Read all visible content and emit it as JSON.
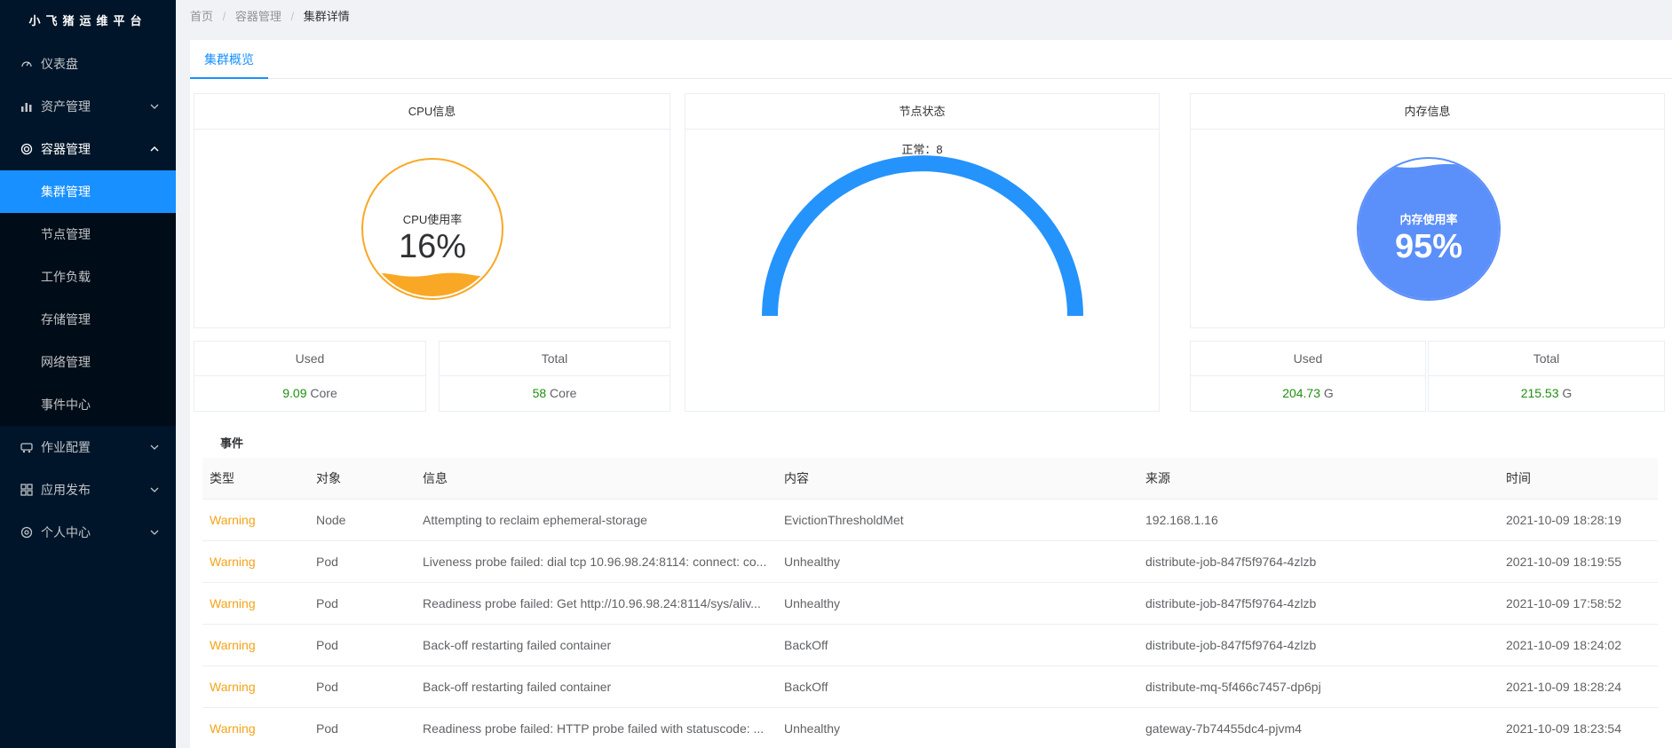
{
  "brand": "小飞猪运维平台",
  "sidebar": {
    "items": [
      {
        "label": "仪表盘",
        "icon": "dashboard-icon"
      },
      {
        "label": "资产管理",
        "icon": "asset-icon"
      },
      {
        "label": "容器管理",
        "icon": "container-icon"
      },
      {
        "label": "作业配置",
        "icon": "job-icon"
      },
      {
        "label": "应用发布",
        "icon": "app-icon"
      },
      {
        "label": "个人中心",
        "icon": "user-icon"
      }
    ],
    "sub_items": [
      {
        "label": "集群管理",
        "active": true
      },
      {
        "label": "节点管理"
      },
      {
        "label": "工作负载"
      },
      {
        "label": "存储管理"
      },
      {
        "label": "网络管理"
      },
      {
        "label": "事件中心"
      }
    ]
  },
  "breadcrumb": {
    "home": "首页",
    "sep": "/",
    "parent": "容器管理",
    "current": "集群详情"
  },
  "tab": {
    "label": "集群概览"
  },
  "cpu": {
    "title": "CPU信息",
    "gauge_label": "CPU使用率",
    "gauge_value": "16%",
    "usage_fraction": 0.16,
    "color": "#f9a825",
    "used_label": "Used",
    "used_value": "9.09",
    "used_unit": "Core",
    "total_label": "Total",
    "total_value": "58",
    "total_unit": "Core"
  },
  "nodes": {
    "title": "节点状态",
    "status_text": "正常：8",
    "color": "#2593fc"
  },
  "memory": {
    "title": "内存信息",
    "gauge_label": "内存使用率",
    "gauge_value": "95%",
    "usage_fraction": 0.95,
    "color": "#5b8ff9",
    "used_label": "Used",
    "used_value": "204.73",
    "used_unit": "G",
    "total_label": "Total",
    "total_value": "215.53",
    "total_unit": "G"
  },
  "events": {
    "title": "事件",
    "columns": [
      "类型",
      "对象",
      "信息",
      "内容",
      "来源",
      "时间"
    ],
    "rows": [
      [
        "Warning",
        "Node",
        "Attempting to reclaim ephemeral-storage",
        "EvictionThresholdMet",
        "192.168.1.16",
        "2021-10-09 18:28:19"
      ],
      [
        "Warning",
        "Pod",
        "Liveness probe failed: dial tcp 10.96.98.24:8114: connect: co...",
        "Unhealthy",
        "distribute-job-847f5f9764-4zlzb",
        "2021-10-09 18:19:55"
      ],
      [
        "Warning",
        "Pod",
        "Readiness probe failed: Get http://10.96.98.24:8114/sys/aliv...",
        "Unhealthy",
        "distribute-job-847f5f9764-4zlzb",
        "2021-10-09 17:58:52"
      ],
      [
        "Warning",
        "Pod",
        "Back-off restarting failed container",
        "BackOff",
        "distribute-job-847f5f9764-4zlzb",
        "2021-10-09 18:24:02"
      ],
      [
        "Warning",
        "Pod",
        "Back-off restarting failed container",
        "BackOff",
        "distribute-mq-5f466c7457-dp6pj",
        "2021-10-09 18:28:24"
      ],
      [
        "Warning",
        "Pod",
        "Readiness probe failed: HTTP probe failed with statuscode: ...",
        "Unhealthy",
        "gateway-7b74455dc4-pjvm4",
        "2021-10-09 18:23:54"
      ]
    ]
  }
}
